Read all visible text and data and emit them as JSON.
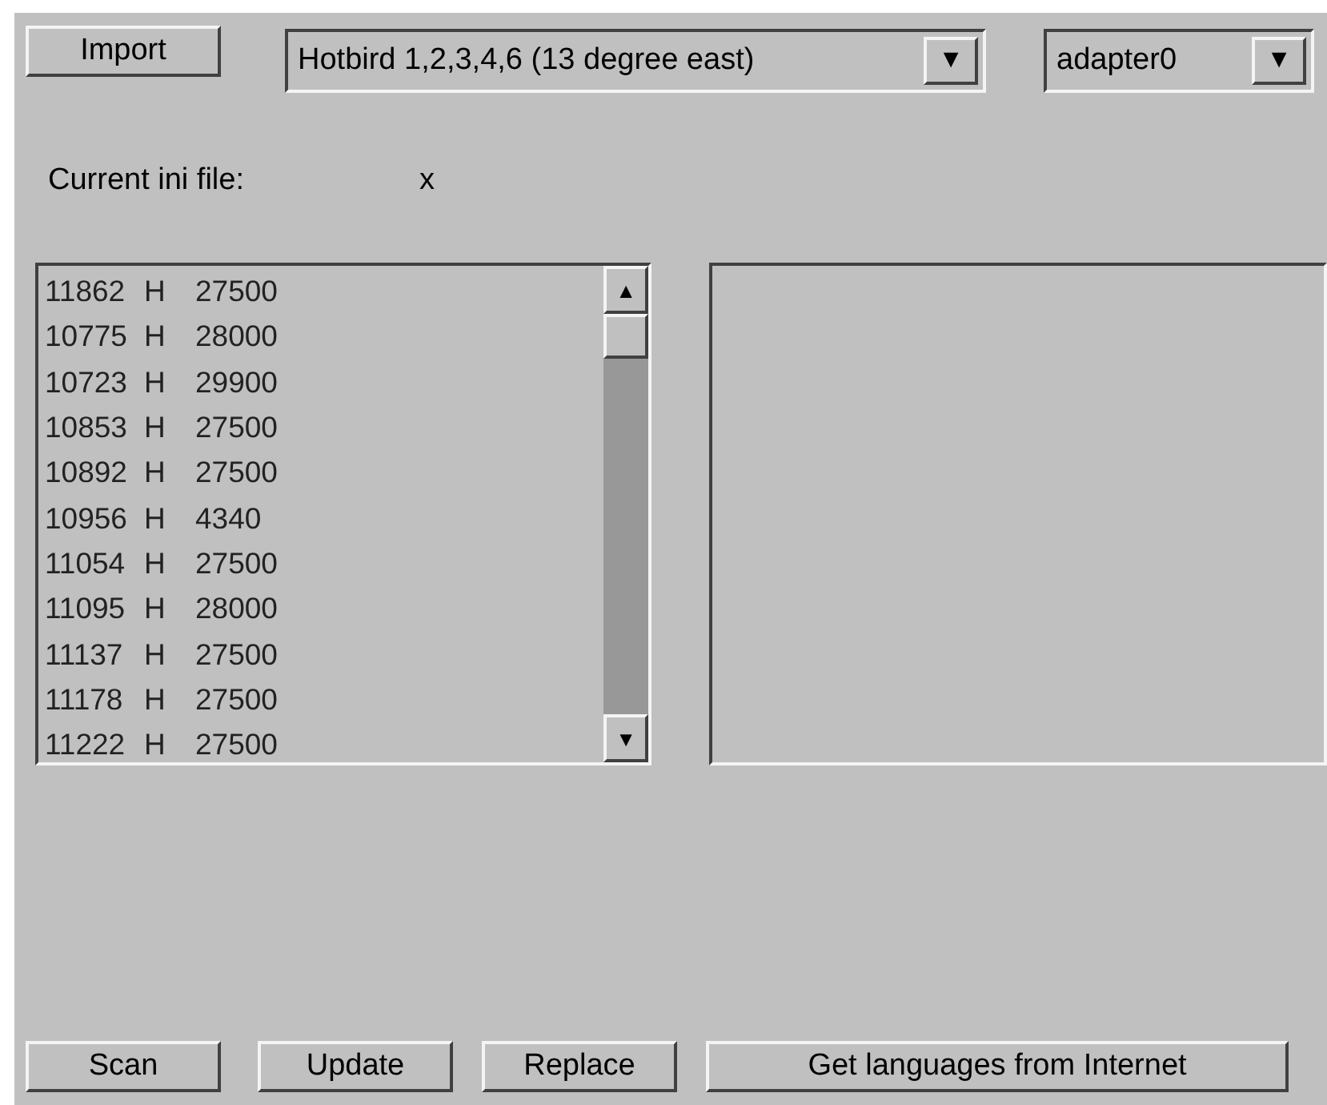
{
  "toolbar": {
    "import_button": "Import",
    "satellite_select": {
      "value": "Hotbird 1,2,3,4,6 (13 degree east)",
      "arrow": "▼"
    },
    "adapter_select": {
      "value": "adapter0",
      "arrow": "▼"
    }
  },
  "ini_file": {
    "label": "Current ini file:",
    "value": "x"
  },
  "transponders": {
    "scroll_up": "▲",
    "scroll_down": "▼",
    "rows": [
      {
        "frequency": "11862",
        "polarization": "H",
        "symbol_rate": "27500"
      },
      {
        "frequency": "10775",
        "polarization": "H",
        "symbol_rate": "28000"
      },
      {
        "frequency": "10723",
        "polarization": "H",
        "symbol_rate": "29900"
      },
      {
        "frequency": "10853",
        "polarization": "H",
        "symbol_rate": "27500"
      },
      {
        "frequency": "10892",
        "polarization": "H",
        "symbol_rate": "27500"
      },
      {
        "frequency": "10956",
        "polarization": "H",
        "symbol_rate": "4340"
      },
      {
        "frequency": "11054",
        "polarization": "H",
        "symbol_rate": "27500"
      },
      {
        "frequency": "11095",
        "polarization": "H",
        "symbol_rate": "28000"
      },
      {
        "frequency": "11137",
        "polarization": "H",
        "symbol_rate": "27500"
      },
      {
        "frequency": "11178",
        "polarization": "H",
        "symbol_rate": "27500"
      },
      {
        "frequency": "11222",
        "polarization": "H",
        "symbol_rate": "27500"
      }
    ]
  },
  "buttons": [
    "Scan",
    "Update",
    "Replace",
    "Get languages from Internet"
  ]
}
